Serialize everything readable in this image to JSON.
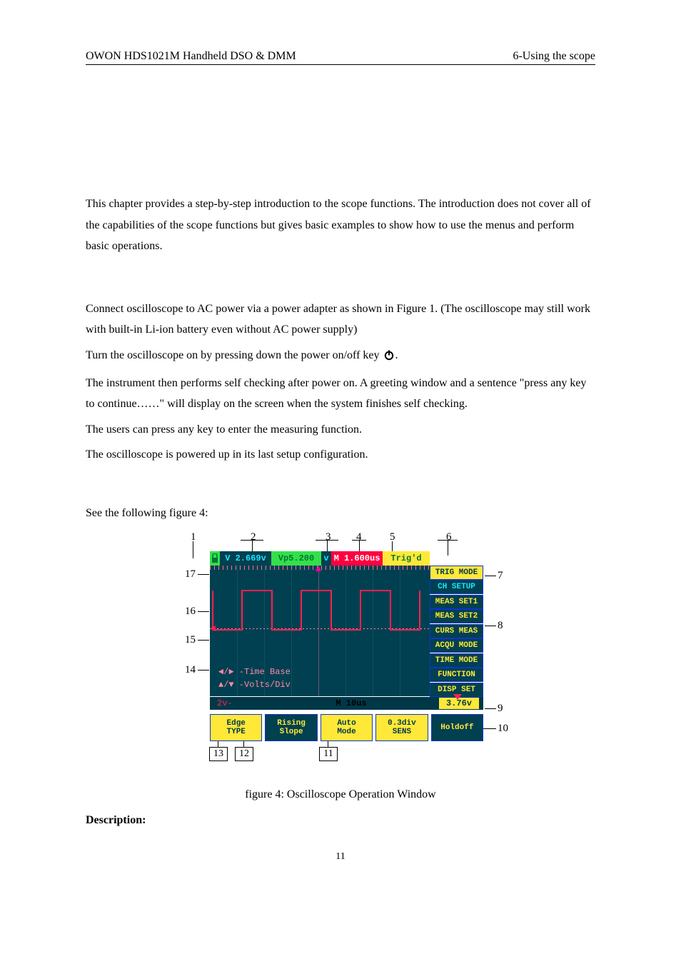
{
  "header": {
    "left": "OWON    HDS1021M Handheld DSO & DMM",
    "right": "6-Using the scope"
  },
  "intro": "This chapter provides a step-by-step introduction to the scope functions. The introduction does not cover all of the capabilities of the scope functions but gives basic examples to show how to use the menus and perform basic operations.",
  "sec61": {
    "p1": "Connect oscilloscope to AC power via a power adapter as shown in Figure 1. (The oscilloscope may still work with built-in Li-ion battery even without AC power supply)",
    "p2a": "Turn the oscilloscope on by pressing down the power on/off key",
    "p2b": ".",
    "p3": "The instrument then performs self checking after power on. A greeting window and a sentence \"press any key to continue……\" will display on the screen when the system finishes self checking.",
    "p4": "The users can press any key to enter the measuring function.",
    "p5": "The oscilloscope is powered up in its last setup configuration."
  },
  "sec62_lead": "See the following figure 4:",
  "fig_caption": "figure 4: Oscilloscope Operation Window",
  "desc_label": "Description:",
  "page_num": "11",
  "callouts": {
    "c1": "1",
    "c2": "2",
    "c3": "3",
    "c4": "4",
    "c5": "5",
    "c6": "6",
    "c7": "7",
    "c8": "8",
    "c9": "9",
    "c10": "10",
    "c11": "11",
    "c12": "12",
    "c13": "13",
    "c14": "14",
    "c15": "15",
    "c16": "16",
    "c17": "17"
  },
  "topbar": {
    "seg1": "",
    "seg2": "V  2.669v",
    "seg3": "Vp5.200",
    "seg4": "v",
    "seg5": "M 1.600us",
    "seg6": "Trig'd"
  },
  "sidepanel": [
    "TRIG MODE",
    "CH SETUP",
    "MEAS SET1",
    "MEAS SET2",
    "CURS MEAS",
    "ACQU MODE",
    "TIME MODE",
    "FUNCTION",
    "DISP SET"
  ],
  "hints": {
    "l1": "◄/► -Time Base",
    "l2": "▲/▼ -Volts/Div"
  },
  "foot1": {
    "left": "2v-",
    "mid": "M 10us",
    "right": "3.76v"
  },
  "foot2": [
    {
      "top": "Edge",
      "bot": "TYPE",
      "hot": true
    },
    {
      "top": "Rising",
      "bot": "Slope",
      "hot": false
    },
    {
      "top": "Auto",
      "bot": "Mode",
      "hot": true
    },
    {
      "top": "0.3div",
      "bot": "SENS",
      "hot": true
    },
    {
      "top": "Holdoff",
      "bot": "",
      "hot": false
    }
  ],
  "bottom_boxes": {
    "b11": "11",
    "b12": "12",
    "b13": "13"
  }
}
